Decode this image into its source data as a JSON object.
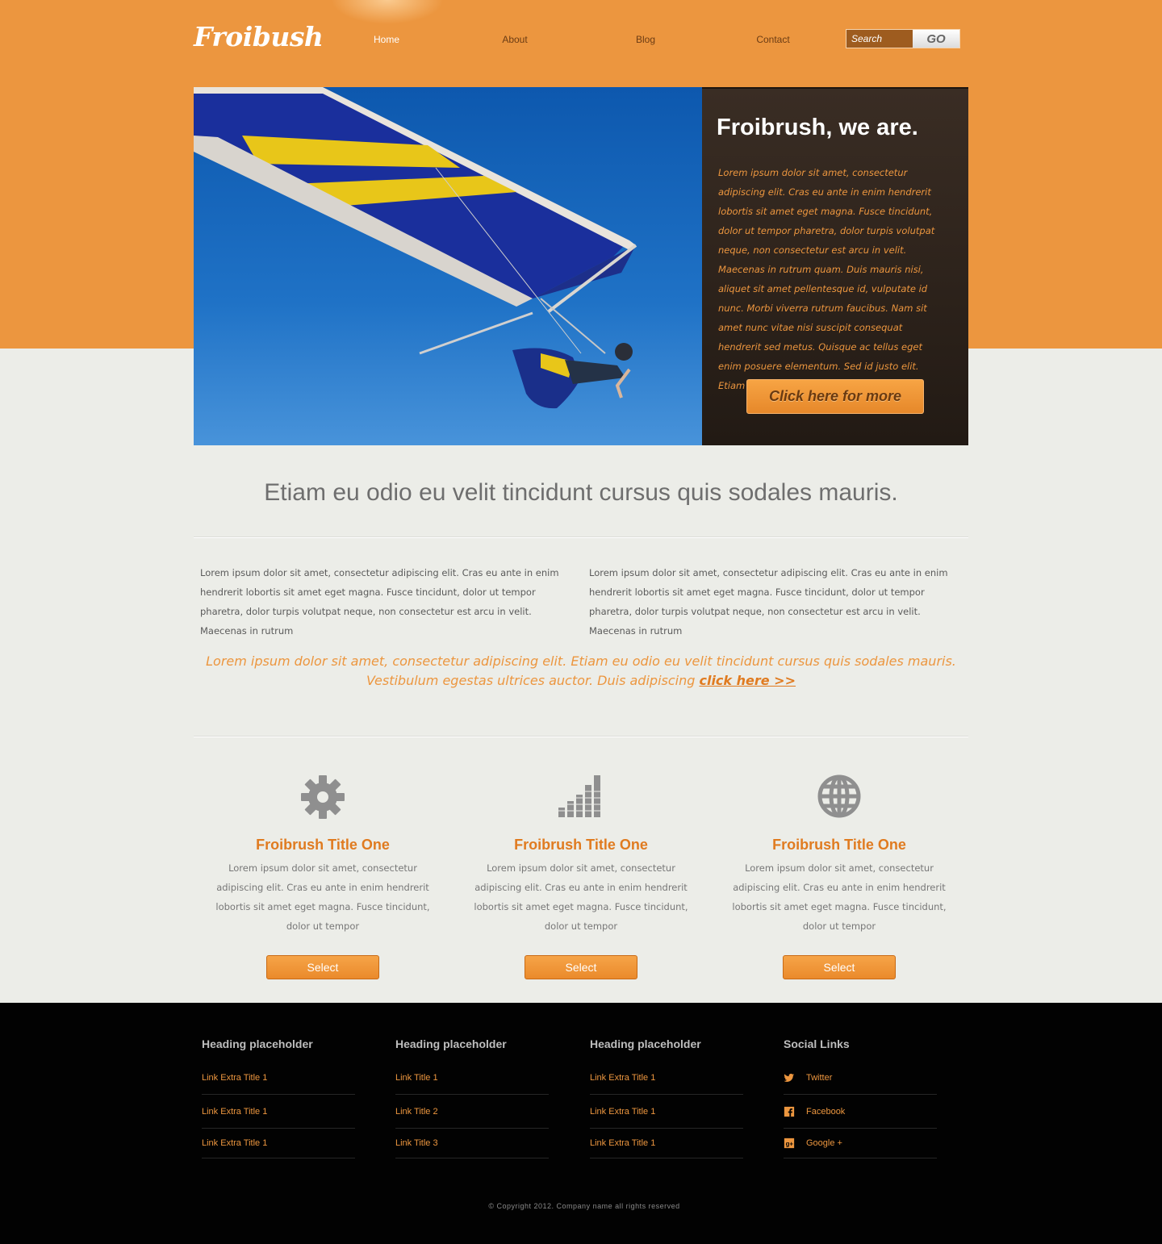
{
  "brand": {
    "logo": "Froibush"
  },
  "nav": [
    {
      "label": "Home",
      "active": true
    },
    {
      "label": "About",
      "active": false
    },
    {
      "label": "Blog",
      "active": false
    },
    {
      "label": "Contact",
      "active": false
    }
  ],
  "search": {
    "placeholder": "Search",
    "button": "GO"
  },
  "hero": {
    "title": "Froibrush, we are.",
    "text": "Lorem ipsum dolor sit amet, consectetur adipiscing elit. Cras eu ante in enim hendrerit lobortis sit amet eget magna. Fusce tincidunt, dolor ut tempor pharetra, dolor turpis volutpat neque, non consectetur est arcu in velit. Maecenas in rutrum quam. Duis mauris nisi, aliquet sit amet pellentesque id, vulputate id nunc. Morbi viverra rutrum faucibus. Nam sit amet nunc vitae nisi suscipit consequat hendrerit sed metus. Quisque ac tellus eget enim posuere elementum. Sed id justo elit. Etiam et sapien",
    "button": "Click here for more",
    "image_alt": "hang-glider"
  },
  "intro": {
    "heading": "Etiam eu odio eu velit tincidunt cursus quis sodales mauris.",
    "col1": "Lorem ipsum dolor sit amet, consectetur adipiscing elit. Cras eu ante in enim hendrerit lobortis sit amet eget magna. Fusce tincidunt, dolor ut tempor pharetra, dolor turpis volutpat neque, non consectetur est arcu in velit. Maecenas in rutrum",
    "col2": "Lorem ipsum dolor sit amet, consectetur adipiscing elit. Cras eu ante in enim hendrerit lobortis sit amet eget magna. Fusce tincidunt, dolor ut tempor pharetra, dolor turpis volutpat neque, non consectetur est arcu in velit. Maecenas in rutrum",
    "quote": "Lorem ipsum dolor sit amet, consectetur adipiscing elit. Etiam eu odio eu velit tincidunt cursus quis sodales mauris. Vestibulum egestas ultrices auctor. Duis adipiscing ",
    "quote_link": "click here >>"
  },
  "features": [
    {
      "icon": "gear-icon",
      "title": "Froibrush Title One",
      "text": "Lorem ipsum dolor sit amet, consectetur adipiscing elit. Cras eu ante in enim hendrerit lobortis sit amet eget magna. Fusce tincidunt, dolor ut tempor",
      "button": "Select"
    },
    {
      "icon": "signal-bars-icon",
      "title": "Froibrush Title One",
      "text": "Lorem ipsum dolor sit amet, consectetur adipiscing elit. Cras eu ante in enim hendrerit lobortis sit amet eget magna. Fusce tincidunt, dolor ut tempor",
      "button": "Select"
    },
    {
      "icon": "globe-icon",
      "title": "Froibrush Title One",
      "text": "Lorem ipsum dolor sit amet, consectetur adipiscing elit. Cras eu ante in enim hendrerit lobortis sit amet eget magna. Fusce tincidunt, dolor ut tempor",
      "button": "Select"
    }
  ],
  "footer": {
    "columns": [
      {
        "heading": "Heading placeholder",
        "links": [
          "Link Extra Title 1",
          "Link Extra Title 1",
          "Link Extra Title 1"
        ]
      },
      {
        "heading": "Heading placeholder",
        "links": [
          "Link Title 1",
          "Link Title 2",
          "Link Title 3"
        ]
      },
      {
        "heading": "Heading placeholder",
        "links": [
          "Link Extra Title 1",
          "Link Extra Title 1",
          "Link Extra Title 1"
        ]
      }
    ],
    "social": {
      "heading": "Social Links",
      "links": [
        {
          "label": "Twitter",
          "icon": "twitter-icon"
        },
        {
          "label": "Facebook",
          "icon": "facebook-icon"
        },
        {
          "label": "Google +",
          "icon": "google-plus-icon"
        }
      ]
    },
    "copyright": "© Copyright 2012. Company name all rights reserved"
  },
  "colors": {
    "brand_orange": "#ec963f",
    "accent_orange": "#e07b20",
    "panel_dark": "#2e241c",
    "footer_bg": "#020202",
    "page_bg": "#ecede8"
  }
}
